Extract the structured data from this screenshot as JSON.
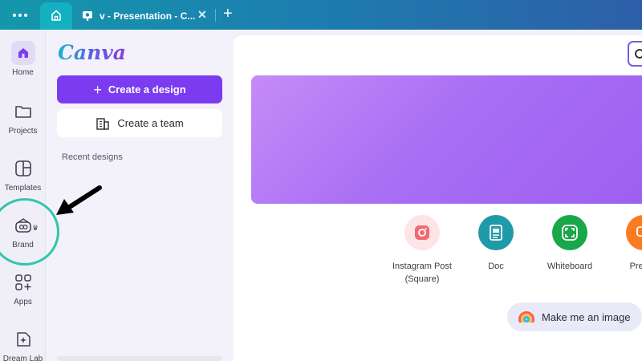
{
  "tabbar": {
    "presentation_tab_title": "v - Presentation - C...",
    "close_glyph": "✕",
    "new_tab_glyph": "+"
  },
  "rail": {
    "items": [
      {
        "label": "Home",
        "icon": "home-icon"
      },
      {
        "label": "Projects",
        "icon": "folder-icon"
      },
      {
        "label": "Templates",
        "icon": "templates-icon"
      },
      {
        "label": "Brand",
        "icon": "brand-icon"
      },
      {
        "label": "Apps",
        "icon": "apps-icon"
      },
      {
        "label": "Dream Lab",
        "icon": "dream-lab-icon"
      }
    ],
    "crown_glyph": "♛"
  },
  "panel": {
    "logo": "Canva",
    "create_design_label": "Create a design",
    "create_team_label": "Create a team",
    "recent_designs_label": "Recent designs"
  },
  "quick_actions": [
    {
      "label": "Instagram Post (Square)",
      "color": "#f06a73",
      "bg": "#fde4e6",
      "icon": "instagram-icon"
    },
    {
      "label": "Doc",
      "color": "#ffffff",
      "bg": "#1f9aa8",
      "icon": "doc-icon"
    },
    {
      "label": "Whiteboard",
      "color": "#ffffff",
      "bg": "#1aa64a",
      "icon": "whiteboard-icon"
    },
    {
      "label": "Presen",
      "color": "#ffffff",
      "bg": "#fb7b22",
      "icon": "presentation-icon"
    }
  ],
  "prompt_pill": {
    "label": "Make me an image",
    "icon": "rainbow-icon"
  },
  "colors": {
    "accent": "#7b3cf0",
    "highlight_ring": "#2fc7ab",
    "banner": "#a96ff4"
  }
}
